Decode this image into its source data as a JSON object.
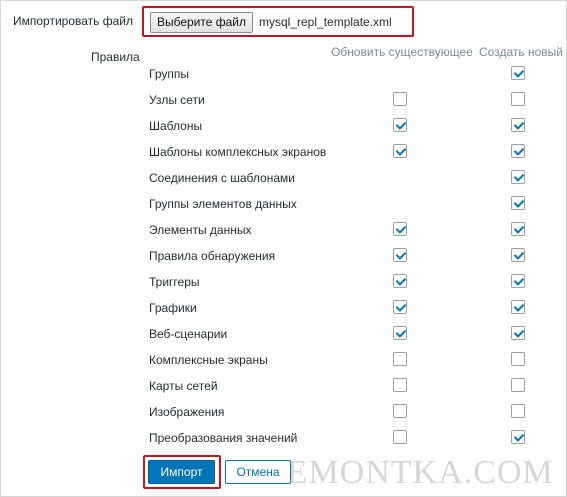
{
  "import_file": {
    "label": "Импортировать файл",
    "button_label": "Выберите файл",
    "file_name": "mysql_repl_template.xml"
  },
  "rules": {
    "label": "Правила",
    "columns": {
      "update": "Обновить существующее",
      "create": "Создать новый"
    },
    "items": [
      {
        "label": "Группы",
        "update": null,
        "create": true
      },
      {
        "label": "Узлы сети",
        "update": false,
        "create": false
      },
      {
        "label": "Шаблоны",
        "update": true,
        "create": true
      },
      {
        "label": "Шаблоны комплексных экранов",
        "update": true,
        "create": true
      },
      {
        "label": "Соединения с шаблонами",
        "update": null,
        "create": true
      },
      {
        "label": "Группы элементов данных",
        "update": null,
        "create": true
      },
      {
        "label": "Элементы данных",
        "update": true,
        "create": true
      },
      {
        "label": "Правила обнаружения",
        "update": true,
        "create": true
      },
      {
        "label": "Триггеры",
        "update": true,
        "create": true
      },
      {
        "label": "Графики",
        "update": true,
        "create": true
      },
      {
        "label": "Веб-сценарии",
        "update": true,
        "create": true
      },
      {
        "label": "Комплексные экраны",
        "update": false,
        "create": false
      },
      {
        "label": "Карты сетей",
        "update": false,
        "create": false
      },
      {
        "label": "Изображения",
        "update": false,
        "create": false
      },
      {
        "label": "Преобразования значений",
        "update": false,
        "create": true
      }
    ]
  },
  "buttons": {
    "import_label": "Импорт",
    "cancel_label": "Отмена"
  },
  "watermark": "REMONTKA.COM",
  "colors": {
    "accent": "#0275b8",
    "highlight_border": "#d0121c"
  }
}
